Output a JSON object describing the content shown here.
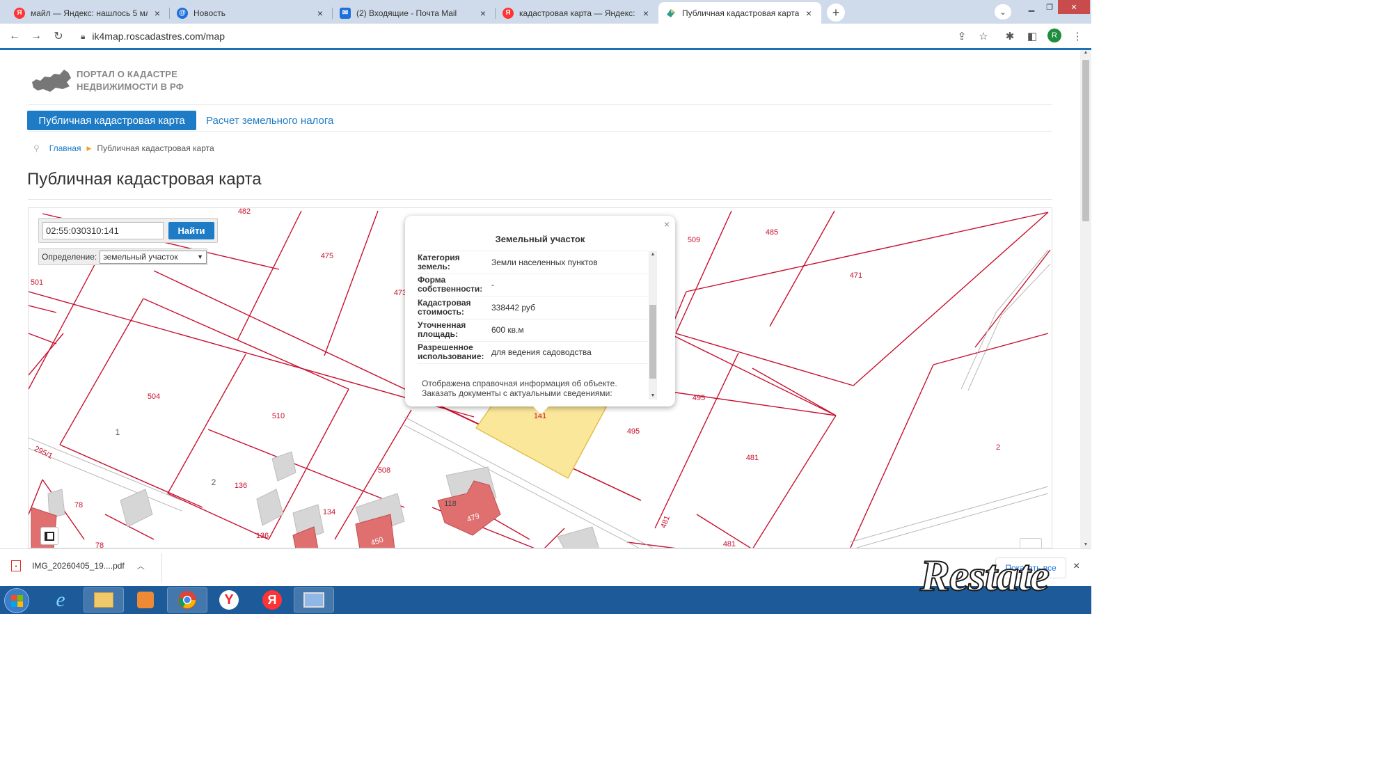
{
  "browser": {
    "tabs": [
      {
        "title": "майл — Яндекс: нашлось 5 млн",
        "icon": "yandex-icon",
        "active": false
      },
      {
        "title": "Новость",
        "icon": "mail-at-icon",
        "active": false
      },
      {
        "title": "(2) Входящие - Почта Mail",
        "icon": "mail-envelope-icon",
        "active": false
      },
      {
        "title": "кадастровая карта — Яндекс: на",
        "icon": "yandex-icon",
        "active": false
      },
      {
        "title": "Публичная кадастровая карта",
        "icon": "rosreestr-icon",
        "active": true
      }
    ],
    "close_glyph": "×",
    "new_tab_glyph": "+",
    "url": "ik4map.roscadastres.com/map",
    "profile_initial": "R"
  },
  "page": {
    "logo_line1": "ПОРТАЛ О КАДАСТРЕ",
    "logo_line2": "НЕДВИЖИМОСТИ В РФ",
    "nav": {
      "active_tab": "Публичная кадастровая карта",
      "tab2": "Расчет земельного налога"
    },
    "breadcrumb": {
      "home": "Главная",
      "current": "Публичная кадастровая карта"
    },
    "heading": "Публичная кадастровая карта"
  },
  "map": {
    "search_value": "02:55:030310:141",
    "search_button": "Найти",
    "definition_label": "Определение:",
    "definition_value": "земельный участок",
    "parcel_labels": [
      "482",
      "475",
      "501",
      "473",
      "509",
      "485",
      "471",
      "504",
      "510",
      "1",
      "295/1",
      "2",
      "136",
      "508",
      "78",
      "134",
      "118",
      "479",
      "450",
      "136",
      "78",
      "141",
      "495",
      "495",
      "481",
      "481",
      "481",
      "2"
    ],
    "colors": {
      "boundary": "#c8102e",
      "selected_fill": "#fbe79a",
      "building_red": "#e07070",
      "building_grey": "#d6d6d6"
    }
  },
  "popup": {
    "title": "Земельный участок",
    "close": "×",
    "rows": [
      {
        "key": "Категория земель:",
        "value": "Земли населенных пунктов"
      },
      {
        "key": "Форма собственности:",
        "value": "-"
      },
      {
        "key": "Кадастровая стоимость:",
        "value": "338442 руб"
      },
      {
        "key": "Уточненная площадь:",
        "value": "600 кв.м"
      },
      {
        "key": "Разрешенное использование:",
        "value": "для ведения садоводства"
      }
    ],
    "note_line1": "Отображена справочная информация об объекте.",
    "note_line2": "Заказать документы с актуальными сведениями:"
  },
  "downloads": {
    "file": "IMG_20260405_19....pdf",
    "show_all": "Показать все",
    "close": "×"
  },
  "taskbar": {
    "items": [
      "ie-icon",
      "explorer-folder-icon",
      "media-player-icon",
      "chrome-icon",
      "yandex-browser-icon",
      "yandex-icon",
      "screen-app-icon"
    ]
  },
  "watermark": "Restate"
}
